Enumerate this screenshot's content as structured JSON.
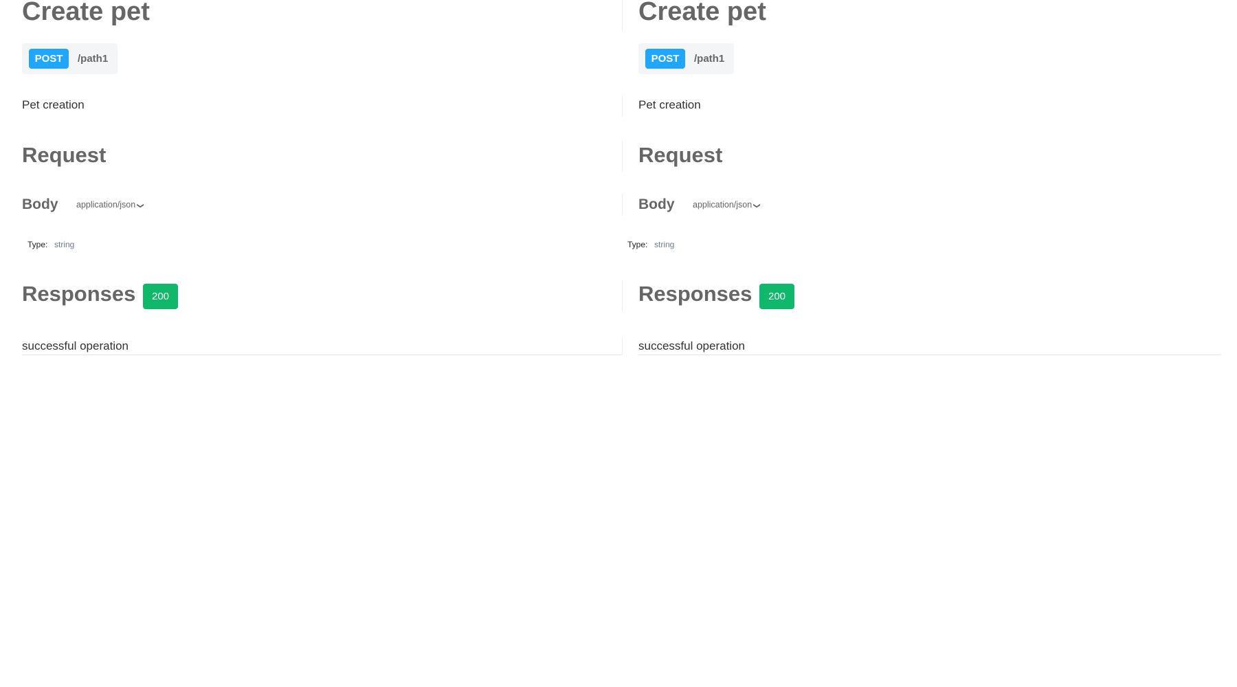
{
  "panels": [
    {
      "title": "Create pet",
      "method": "POST",
      "path": "/path1",
      "description": "Pet creation",
      "request_heading": "Request",
      "body_label": "Body",
      "content_type": "application/json",
      "type_label": "Type:",
      "type_value": "string",
      "responses_heading": "Responses",
      "status_code": "200",
      "response_description": "successful operation"
    },
    {
      "title": "Create pet",
      "method": "POST",
      "path": "/path1",
      "description": "Pet creation",
      "request_heading": "Request",
      "body_label": "Body",
      "content_type": "application/json",
      "type_label": "Type:",
      "type_value": "string",
      "responses_heading": "Responses",
      "status_code": "200",
      "response_description": "successful operation"
    }
  ],
  "colors": {
    "post": "#1ea7fd",
    "success": "#10b86b"
  }
}
